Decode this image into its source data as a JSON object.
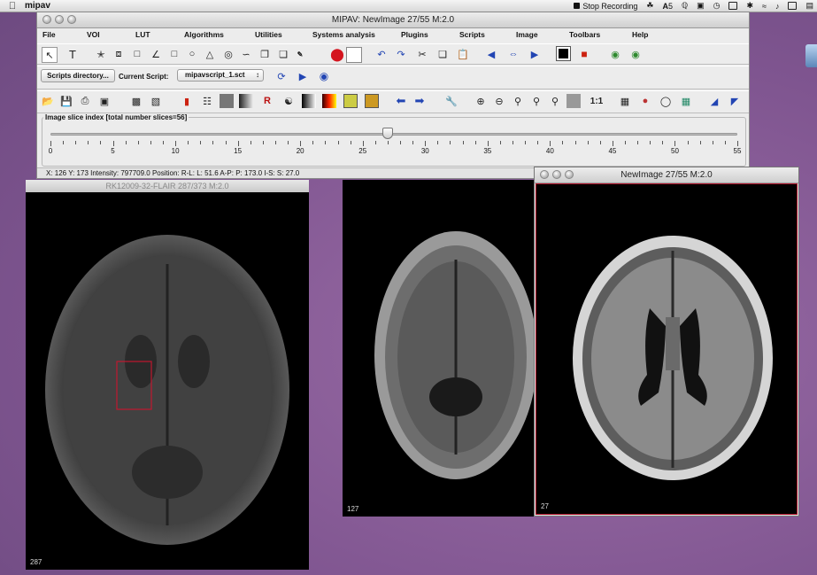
{
  "menubar": {
    "app_name": "mipav",
    "stop_recording": "Stop Recording",
    "badge_num": "5"
  },
  "main_window": {
    "title": "MIPAV: NewImage  27/55 M:2.0",
    "menus": [
      {
        "label": "File"
      },
      {
        "label": "VOI"
      },
      {
        "label": "LUT"
      },
      {
        "label": "Algorithms"
      },
      {
        "label": "Utilities"
      },
      {
        "label": "Systems analysis"
      },
      {
        "label": "Plugins"
      },
      {
        "label": "Scripts"
      },
      {
        "label": "Image"
      },
      {
        "label": "Toolbars"
      },
      {
        "label": "Help"
      }
    ],
    "scripts": {
      "dir_button": "Scripts directory...",
      "current_label": "Current Script:",
      "current_value": "mipavscript_1.sct"
    },
    "zoom_label": "1:1",
    "slider": {
      "label": "Image slice index  [total number slices=56]",
      "min": 0,
      "max": 55,
      "value": 27,
      "tick_labels": [
        "0",
        "5",
        "10",
        "15",
        "20",
        "25",
        "30",
        "35",
        "40",
        "45",
        "50",
        "55"
      ]
    },
    "status": "X: 126 Y: 173  Intensity:  797709.0 Position: R-L: L: 51.6 A-P: P: 173.0 I-S: S: 27.0"
  },
  "left_image": {
    "title": "RK12009-32-FLAIR  287/373 M:2.0",
    "slice": "287"
  },
  "middle_image": {
    "slice": "127"
  },
  "right_image": {
    "title": "NewImage  27/55 M:2.0",
    "slice": "27"
  },
  "colors": {
    "roi": "#c0182f",
    "desktop": "#8a5f95"
  }
}
